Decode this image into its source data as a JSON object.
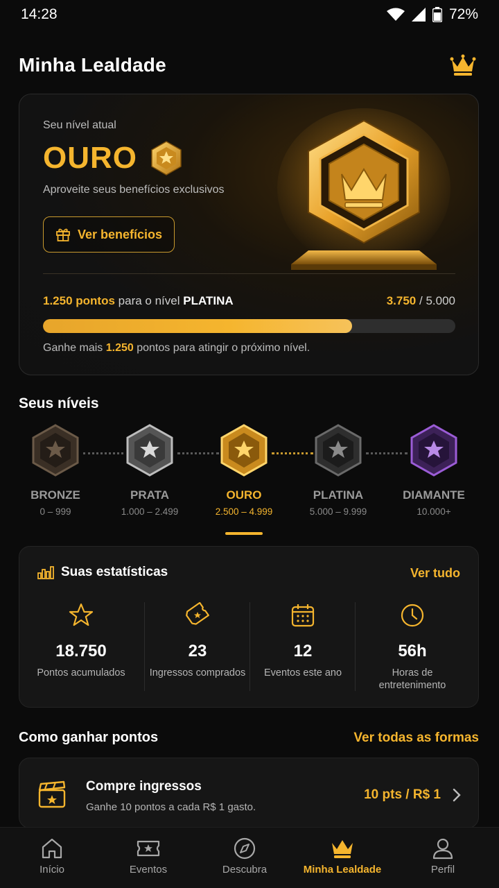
{
  "status_bar": {
    "time": "14:28",
    "battery": "72%"
  },
  "header": {
    "title": "Minha Lealdade",
    "icon": "crown-icon"
  },
  "level_card": {
    "label": "Seu nível atual",
    "level": "OURO",
    "subtitle": "Aproveite seus benefícios exclusivos",
    "button": "Ver benefícios",
    "points_to_next": "1.250 pontos",
    "to_next_text": "para o nível",
    "next_level": "PLATINA",
    "current_points": "3.750",
    "target_points": "5.000",
    "progress": 0.75,
    "hint_prefix": "Ganhe mais",
    "hint_value": "1.250",
    "hint_suffix": "pontos para atingir o próximo nível."
  },
  "levels": {
    "title": "Seus níveis",
    "items": [
      {
        "name": "BRONZE",
        "range": "0 – 999",
        "color": "#6b5a48"
      },
      {
        "name": "PRATA",
        "range": "1.000 – 2.499",
        "color": "#a9a9a9"
      },
      {
        "name": "OURO",
        "range": "2.500 – 4.999",
        "color": "#f5b52e"
      },
      {
        "name": "PLATINA",
        "range": "5.000 – 9.999",
        "color": "#5c5c5c"
      },
      {
        "name": "DIAMANTE",
        "range": "10.000+",
        "color": "#9b5cd6"
      }
    ]
  },
  "stats": {
    "title": "Suas estatísticas",
    "see_all": "Ver tudo",
    "items": [
      {
        "value": "18.750",
        "label": "Pontos acumulados",
        "icon": "star-icon"
      },
      {
        "value": "23",
        "label": "Ingressos comprados",
        "icon": "ticket-icon"
      },
      {
        "value": "12",
        "label": "Eventos este ano",
        "icon": "calendar-icon"
      },
      {
        "value": "56h",
        "label": "Horas de entretenimento",
        "icon": "clock-icon"
      }
    ]
  },
  "earn": {
    "title": "Como ganhar pontos",
    "link": "Ver todas as formas",
    "card": {
      "title": "Compre ingressos",
      "subtitle": "Ganhe 10 pontos a cada R$ 1 gasto.",
      "rate": "10 pts / R$ 1"
    }
  },
  "nav": [
    {
      "label": "Início",
      "icon": "home-icon"
    },
    {
      "label": "Eventos",
      "icon": "ticket-star-icon"
    },
    {
      "label": "Descubra",
      "icon": "compass-icon"
    },
    {
      "label": "Minha Lealdade",
      "icon": "crown-icon",
      "active": true
    },
    {
      "label": "Perfil",
      "icon": "user-icon"
    }
  ],
  "accent_color": "#f5b52e"
}
